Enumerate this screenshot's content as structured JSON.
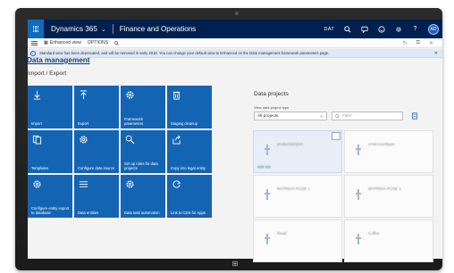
{
  "navbar": {
    "app_name": "Dynamics 365",
    "module": "Finance and Operations",
    "company": "DAT",
    "user_initials": "AD",
    "icons": [
      "search-icon",
      "chat-icon",
      "smiley-icon",
      "gear-icon",
      "help-icon"
    ]
  },
  "actionpane": {
    "view_label": "Enhanced view",
    "options_label": "OPTIONS"
  },
  "message": {
    "text": "Standard view has been deprecated, and will be removed in early 2018. You can change your default view to Enhanced on the Data management framework parameters page."
  },
  "workspace": {
    "title": "Data management",
    "import_export_title": "Import / Export",
    "data_projects_title": "Data projects"
  },
  "tiles": [
    {
      "label": "Import",
      "icon": "import-arrow-icon"
    },
    {
      "label": "Export",
      "icon": "export-arrow-icon"
    },
    {
      "label": "Framework parameters",
      "icon": "gear-icon"
    },
    {
      "label": "Staging cleanup",
      "icon": "trash-icon"
    },
    {
      "label": "Templates",
      "icon": "template-icon"
    },
    {
      "label": "Configure data source",
      "icon": "gear-icon"
    },
    {
      "label": "Set up roles for data projects",
      "icon": "search-icon"
    },
    {
      "label": "Copy into legal entity",
      "icon": "share-icon"
    },
    {
      "label": "Configure entity export to database",
      "icon": "gear-icon"
    },
    {
      "label": "Data entities",
      "icon": "list-icon"
    },
    {
      "label": "Data task automation",
      "icon": "gear-icon"
    },
    {
      "label": "Link to CDS for Apps",
      "icon": "refresh-icon",
      "selected": true
    }
  ],
  "data_projects": {
    "filter_caption": "View data project type",
    "type_value": "All projects",
    "filter_placeholder": "Filter",
    "projects": [
      {
        "name": "productsimport"
      },
      {
        "name": "vmaccounttype"
      },
      {
        "name": "MYPRDIA PCDE 1"
      },
      {
        "name": "MYPRDIA PCDE 1"
      },
      {
        "name": "Read"
      },
      {
        "name": "Coffee"
      }
    ]
  }
}
